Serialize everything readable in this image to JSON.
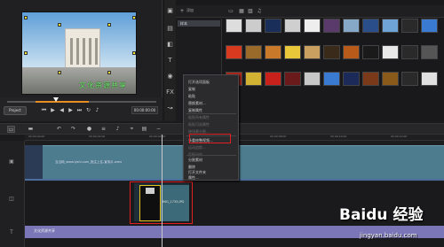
{
  "preview": {
    "caption": "文化资源共享",
    "project_label": "Project",
    "timecode": "00:00:00:00"
  },
  "library": {
    "add_label": "添加",
    "folder_label": "样本",
    "thumb_labels_row1": [
      "",
      "",
      "",
      "",
      "",
      "",
      "",
      "",
      "",
      "",
      ""
    ],
    "thumb_labels_row2": [
      "",
      "",
      "",
      "",
      "",
      "",
      "",
      "",
      "",
      "",
      ""
    ],
    "thumb_labels_row3": [
      "",
      "",
      "",
      "",
      "",
      "",
      "",
      "",
      "",
      "",
      ""
    ]
  },
  "context_menu": {
    "items": [
      {
        "label": "打开选项面板",
        "disabled": false
      },
      {
        "label": "复制",
        "disabled": false
      },
      {
        "label": "粘贴",
        "disabled": false
      },
      {
        "label": "替换素材...",
        "disabled": false
      },
      {
        "label": "复制属性",
        "disabled": false
      },
      {
        "label": "粘贴所有属性",
        "disabled": true
      },
      {
        "label": "粘贴可选属性",
        "disabled": true
      },
      {
        "label": "按场景分割...",
        "disabled": true
      },
      {
        "label": "多重修整视频...",
        "disabled": false
      },
      {
        "label": "运动追踪...",
        "disabled": true
      },
      {
        "label": "匹配动作...",
        "disabled": true
      },
      {
        "label": "分割素材",
        "disabled": false
      },
      {
        "label": "删除",
        "disabled": false
      },
      {
        "label": "打开文件夹",
        "disabled": false
      },
      {
        "label": "属性...",
        "disabled": false
      }
    ]
  },
  "timeline": {
    "ruler_labels": [
      "00:00:00:00",
      "00:00:02:00",
      "00:00:04:00",
      "00:00:06:00",
      "00:00:08:00",
      "00:00:10:00",
      "00:00:12:00"
    ],
    "video_clip_text": "当当网_www.lyshi.com_批注上往-宣传片.wmv",
    "overlay_clip_text": "IMG_1735.JPG",
    "title_clip_text": "文化资源共享"
  },
  "watermark": {
    "logo": "Baidu 经验",
    "url": "jingyan.baidu.com"
  }
}
